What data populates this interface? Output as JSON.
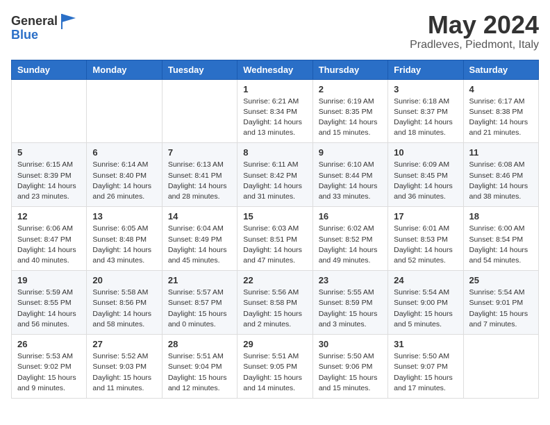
{
  "header": {
    "logo_general": "General",
    "logo_blue": "Blue",
    "month": "May 2024",
    "location": "Pradleves, Piedmont, Italy"
  },
  "days_of_week": [
    "Sunday",
    "Monday",
    "Tuesday",
    "Wednesday",
    "Thursday",
    "Friday",
    "Saturday"
  ],
  "weeks": [
    [
      {
        "day": "",
        "info": ""
      },
      {
        "day": "",
        "info": ""
      },
      {
        "day": "",
        "info": ""
      },
      {
        "day": "1",
        "info": "Sunrise: 6:21 AM\nSunset: 8:34 PM\nDaylight: 14 hours\nand 13 minutes."
      },
      {
        "day": "2",
        "info": "Sunrise: 6:19 AM\nSunset: 8:35 PM\nDaylight: 14 hours\nand 15 minutes."
      },
      {
        "day": "3",
        "info": "Sunrise: 6:18 AM\nSunset: 8:37 PM\nDaylight: 14 hours\nand 18 minutes."
      },
      {
        "day": "4",
        "info": "Sunrise: 6:17 AM\nSunset: 8:38 PM\nDaylight: 14 hours\nand 21 minutes."
      }
    ],
    [
      {
        "day": "5",
        "info": "Sunrise: 6:15 AM\nSunset: 8:39 PM\nDaylight: 14 hours\nand 23 minutes."
      },
      {
        "day": "6",
        "info": "Sunrise: 6:14 AM\nSunset: 8:40 PM\nDaylight: 14 hours\nand 26 minutes."
      },
      {
        "day": "7",
        "info": "Sunrise: 6:13 AM\nSunset: 8:41 PM\nDaylight: 14 hours\nand 28 minutes."
      },
      {
        "day": "8",
        "info": "Sunrise: 6:11 AM\nSunset: 8:42 PM\nDaylight: 14 hours\nand 31 minutes."
      },
      {
        "day": "9",
        "info": "Sunrise: 6:10 AM\nSunset: 8:44 PM\nDaylight: 14 hours\nand 33 minutes."
      },
      {
        "day": "10",
        "info": "Sunrise: 6:09 AM\nSunset: 8:45 PM\nDaylight: 14 hours\nand 36 minutes."
      },
      {
        "day": "11",
        "info": "Sunrise: 6:08 AM\nSunset: 8:46 PM\nDaylight: 14 hours\nand 38 minutes."
      }
    ],
    [
      {
        "day": "12",
        "info": "Sunrise: 6:06 AM\nSunset: 8:47 PM\nDaylight: 14 hours\nand 40 minutes."
      },
      {
        "day": "13",
        "info": "Sunrise: 6:05 AM\nSunset: 8:48 PM\nDaylight: 14 hours\nand 43 minutes."
      },
      {
        "day": "14",
        "info": "Sunrise: 6:04 AM\nSunset: 8:49 PM\nDaylight: 14 hours\nand 45 minutes."
      },
      {
        "day": "15",
        "info": "Sunrise: 6:03 AM\nSunset: 8:51 PM\nDaylight: 14 hours\nand 47 minutes."
      },
      {
        "day": "16",
        "info": "Sunrise: 6:02 AM\nSunset: 8:52 PM\nDaylight: 14 hours\nand 49 minutes."
      },
      {
        "day": "17",
        "info": "Sunrise: 6:01 AM\nSunset: 8:53 PM\nDaylight: 14 hours\nand 52 minutes."
      },
      {
        "day": "18",
        "info": "Sunrise: 6:00 AM\nSunset: 8:54 PM\nDaylight: 14 hours\nand 54 minutes."
      }
    ],
    [
      {
        "day": "19",
        "info": "Sunrise: 5:59 AM\nSunset: 8:55 PM\nDaylight: 14 hours\nand 56 minutes."
      },
      {
        "day": "20",
        "info": "Sunrise: 5:58 AM\nSunset: 8:56 PM\nDaylight: 14 hours\nand 58 minutes."
      },
      {
        "day": "21",
        "info": "Sunrise: 5:57 AM\nSunset: 8:57 PM\nDaylight: 15 hours\nand 0 minutes."
      },
      {
        "day": "22",
        "info": "Sunrise: 5:56 AM\nSunset: 8:58 PM\nDaylight: 15 hours\nand 2 minutes."
      },
      {
        "day": "23",
        "info": "Sunrise: 5:55 AM\nSunset: 8:59 PM\nDaylight: 15 hours\nand 3 minutes."
      },
      {
        "day": "24",
        "info": "Sunrise: 5:54 AM\nSunset: 9:00 PM\nDaylight: 15 hours\nand 5 minutes."
      },
      {
        "day": "25",
        "info": "Sunrise: 5:54 AM\nSunset: 9:01 PM\nDaylight: 15 hours\nand 7 minutes."
      }
    ],
    [
      {
        "day": "26",
        "info": "Sunrise: 5:53 AM\nSunset: 9:02 PM\nDaylight: 15 hours\nand 9 minutes."
      },
      {
        "day": "27",
        "info": "Sunrise: 5:52 AM\nSunset: 9:03 PM\nDaylight: 15 hours\nand 11 minutes."
      },
      {
        "day": "28",
        "info": "Sunrise: 5:51 AM\nSunset: 9:04 PM\nDaylight: 15 hours\nand 12 minutes."
      },
      {
        "day": "29",
        "info": "Sunrise: 5:51 AM\nSunset: 9:05 PM\nDaylight: 15 hours\nand 14 minutes."
      },
      {
        "day": "30",
        "info": "Sunrise: 5:50 AM\nSunset: 9:06 PM\nDaylight: 15 hours\nand 15 minutes."
      },
      {
        "day": "31",
        "info": "Sunrise: 5:50 AM\nSunset: 9:07 PM\nDaylight: 15 hours\nand 17 minutes."
      },
      {
        "day": "",
        "info": ""
      }
    ]
  ]
}
